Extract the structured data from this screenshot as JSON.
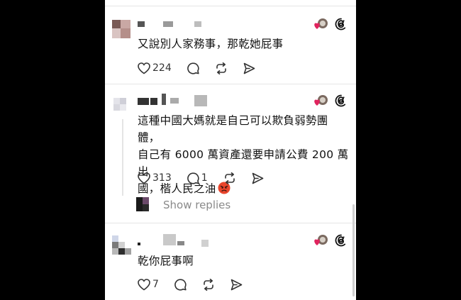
{
  "comments": [
    {
      "text": "又說別人家務事，那乾她屁事",
      "likes": "224",
      "replies": ""
    },
    {
      "line1": "這種中國大媽就是自己可以欺負弱勢團體，",
      "line2": "自己有 6000 萬資產還要申請公費 200 萬出",
      "line3": "國，楷人民之油",
      "emoji": "angry-face",
      "likes": "313",
      "replies": "1"
    },
    {
      "text": "乾你屁事啊",
      "likes": "7",
      "replies": ""
    }
  ],
  "show_replies_label": "Show replies",
  "icons": [
    "heart-icon",
    "comment-icon",
    "repost-icon",
    "share-icon",
    "threads-logo-icon",
    "avatar-heart-badge"
  ],
  "colors": {
    "background": "#000000",
    "panel": "#ffffff",
    "heart_badge": "#e0245e",
    "angry_emoji": "#e8452c"
  }
}
